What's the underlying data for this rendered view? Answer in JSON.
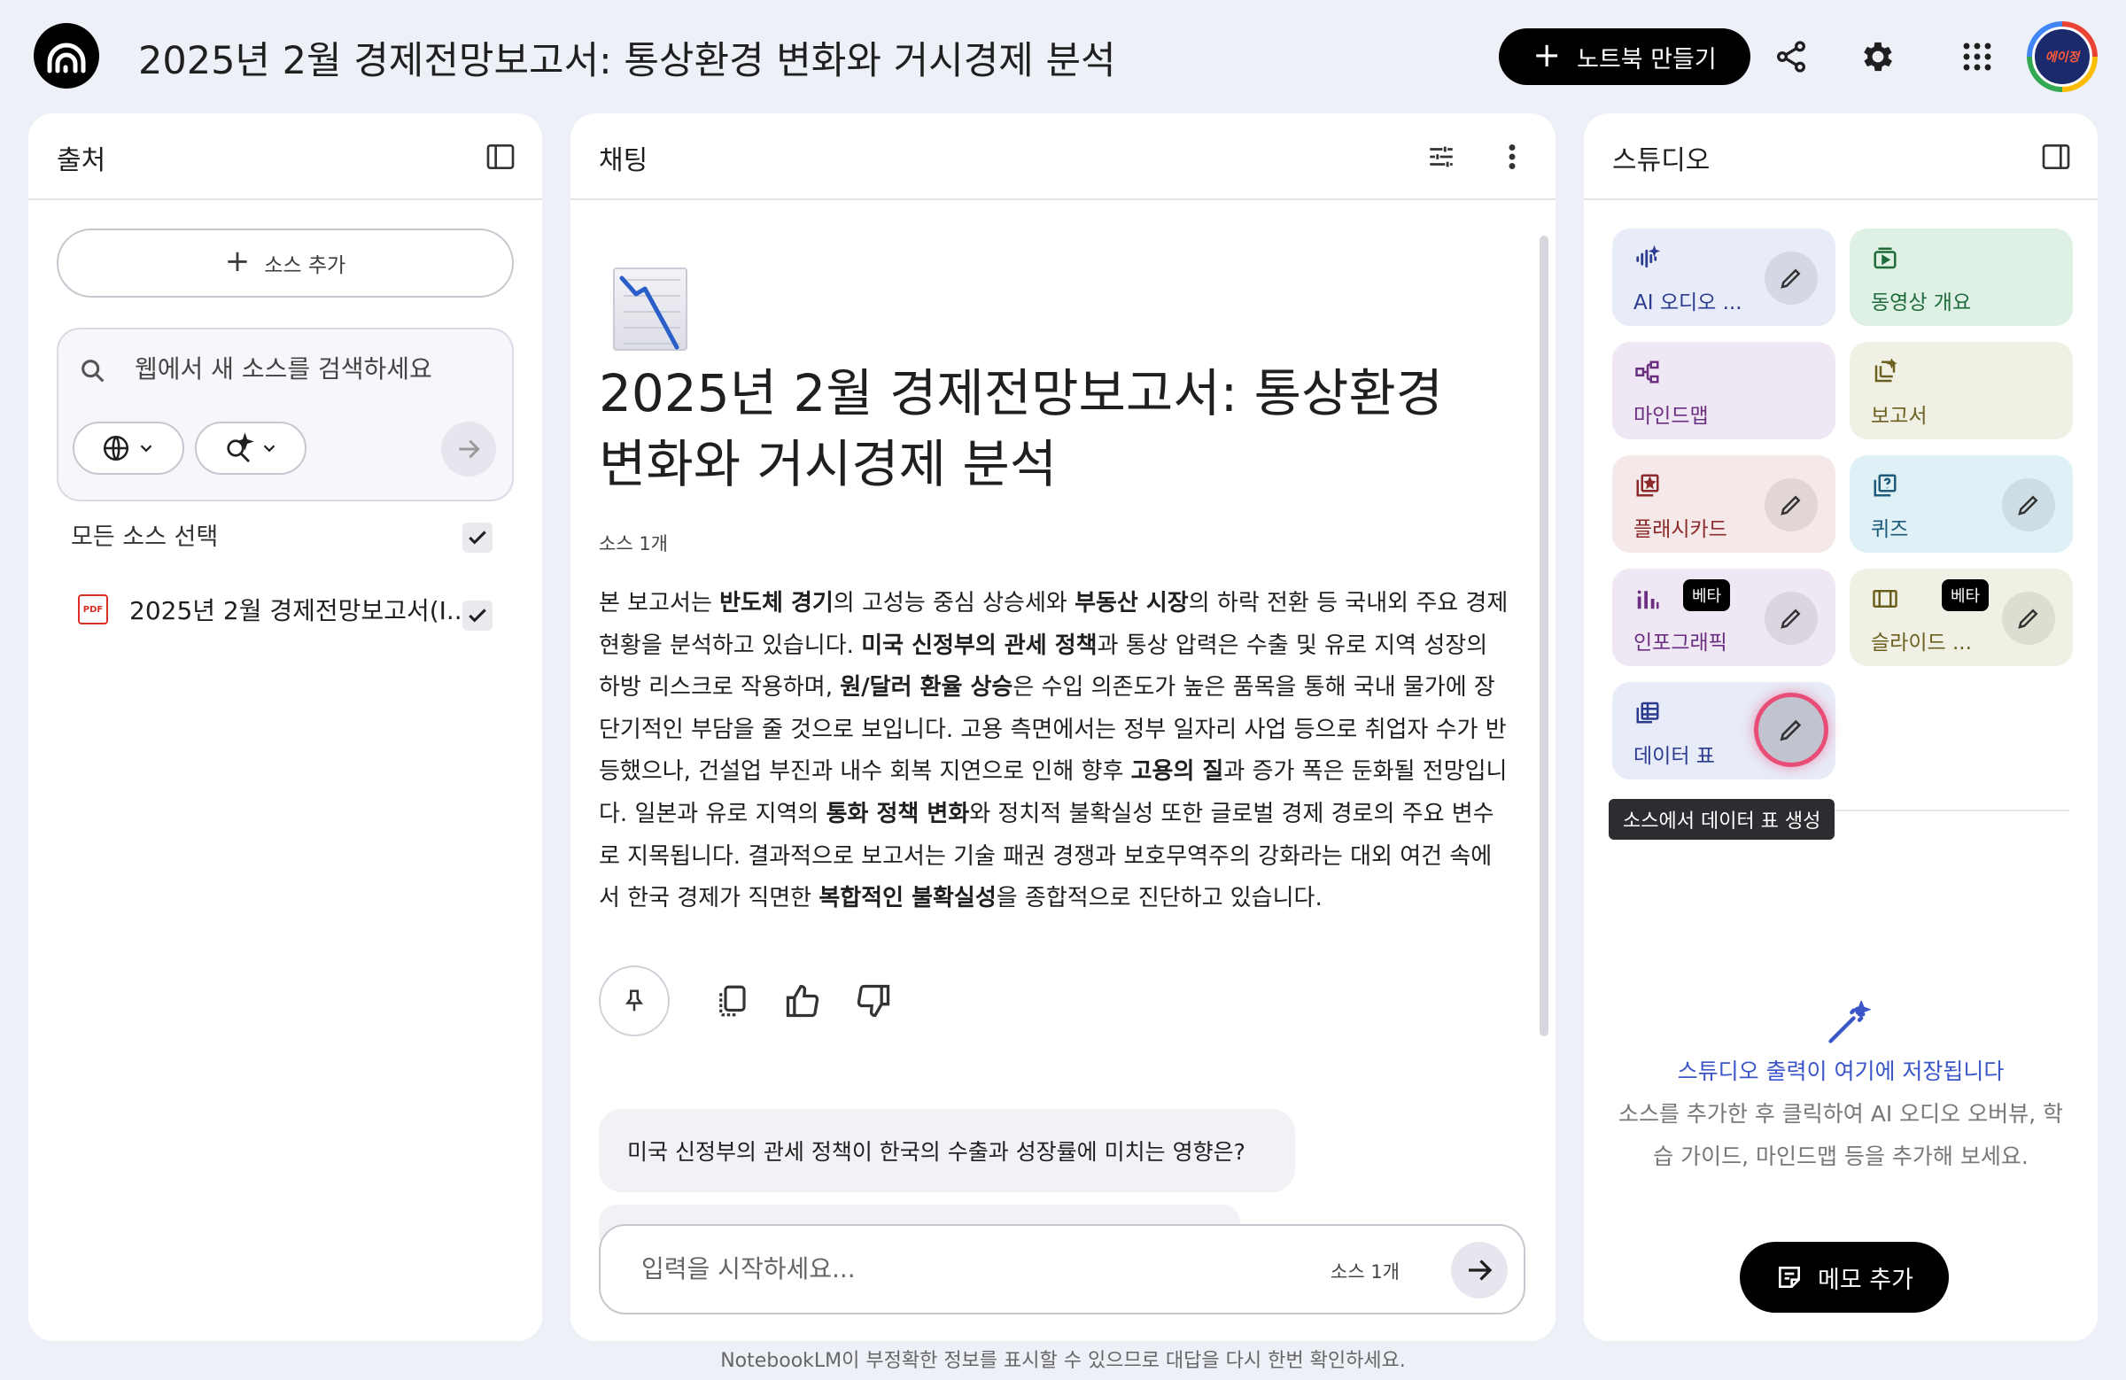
{
  "header": {
    "title": "2025년 2월 경제전망보고서: 통상환경 변화와 거시경제 분석",
    "create_label": "노트북 만들기",
    "avatar_text": "에이정"
  },
  "sources": {
    "title": "출처",
    "add_label": "소스 추가",
    "search_placeholder": "웹에서 새 소스를 검색하세요",
    "select_all_label": "모든 소스 선택",
    "items": [
      {
        "name": "2025년 2월 경제전망보고서(I...",
        "type": "PDF",
        "checked": true
      }
    ]
  },
  "chat": {
    "title": "채팅",
    "notebook_title": "2025년 2월 경제전망보고서: 통상환경 변화와 거시경제 분석",
    "source_count": "소스 1개",
    "summary": [
      {
        "t": "본 보고서는 "
      },
      {
        "t": "반도체 경기",
        "b": true
      },
      {
        "t": "의 고성능 중심 상승세와 "
      },
      {
        "t": "부동산 시장",
        "b": true
      },
      {
        "t": "의 하락 전환 등 국내외 주요 경제 현황을 분석하고 있습니다. "
      },
      {
        "t": "미국 신정부의 관세 정책",
        "b": true
      },
      {
        "t": "과 통상 압력은 수출 및 유로 지역 성장의 하방 리스크로 작용하며, "
      },
      {
        "t": "원/달러 환율 상승",
        "b": true
      },
      {
        "t": "은 수입 의존도가 높은 품목을 통해 국내 물가에 장단기적인 부담을 줄 것으로 보입니다. 고용 측면에서는 정부 일자리 사업 등으로 취업자 수가 반등했으나, 건설업 부진과 내수 회복 지연으로 인해 향후 "
      },
      {
        "t": "고용의 질",
        "b": true
      },
      {
        "t": "과 증가 폭은 둔화될 전망입니다. 일본과 유로 지역의 "
      },
      {
        "t": "통화 정책 변화",
        "b": true
      },
      {
        "t": "와 정치적 불확실성 또한 글로벌 경제 경로의 주요 변수로 지목됩니다. 결과적으로 보고서는 기술 패권 경쟁과 보호무역주의 강화라는 대외 여건 속에서 한국 경제가 직면한 "
      },
      {
        "t": "복합적인 불확실성",
        "b": true
      },
      {
        "t": "을 종합적으로 진단하고 있습니다."
      }
    ],
    "suggested_question": "미국 신정부의 관세 정책이 한국의 수출과 성장률에 미치는 영향은?",
    "input_placeholder": "입력을 시작하세요...",
    "input_source_count": "소스 1개"
  },
  "studio": {
    "title": "스튜디오",
    "tiles": [
      {
        "label": "AI 오디오 ...",
        "bg": "#e8ebf8",
        "color": "#2b3b8f",
        "edit": true,
        "beta": false
      },
      {
        "label": "동영상 개요",
        "bg": "#dff0e4",
        "color": "#1e6b3a",
        "edit": false,
        "beta": false
      },
      {
        "label": "마인드맵",
        "bg": "#efe7f3",
        "color": "#6a2f80",
        "edit": false,
        "beta": false
      },
      {
        "label": "보고서",
        "bg": "#f1f0e4",
        "color": "#6b6020",
        "edit": false,
        "beta": false
      },
      {
        "label": "플래시카드",
        "bg": "#f5e8e8",
        "color": "#8a2a2a",
        "edit": true,
        "beta": false
      },
      {
        "label": "퀴즈",
        "bg": "#dff0f7",
        "color": "#1d5b78",
        "edit": true,
        "beta": false
      },
      {
        "label": "인포그래픽",
        "bg": "#efe7f3",
        "color": "#6a2f80",
        "edit": true,
        "beta": true
      },
      {
        "label": "슬라이드 ...",
        "bg": "#f1f0e4",
        "color": "#6b6020",
        "edit": true,
        "beta": true
      },
      {
        "label": "데이터 표",
        "bg": "#e8ebf8",
        "color": "#2b3b8f",
        "edit": true,
        "beta": false
      }
    ],
    "beta_label": "베타",
    "tooltip": "소스에서 데이터 표 생성",
    "empty_title": "스튜디오 출력이 여기에 저장됩니다",
    "empty_desc": "소스를 추가한 후 클릭하여 AI 오디오 오버뷰, 학습 가이드, 마인드맵 등을 추가해 보세요.",
    "memo_label": "메모 추가"
  },
  "footer": {
    "disclaimer": "NotebookLM이 부정확한 정보를 표시할 수 있으므로 대답을 다시 한번 확인하세요."
  }
}
